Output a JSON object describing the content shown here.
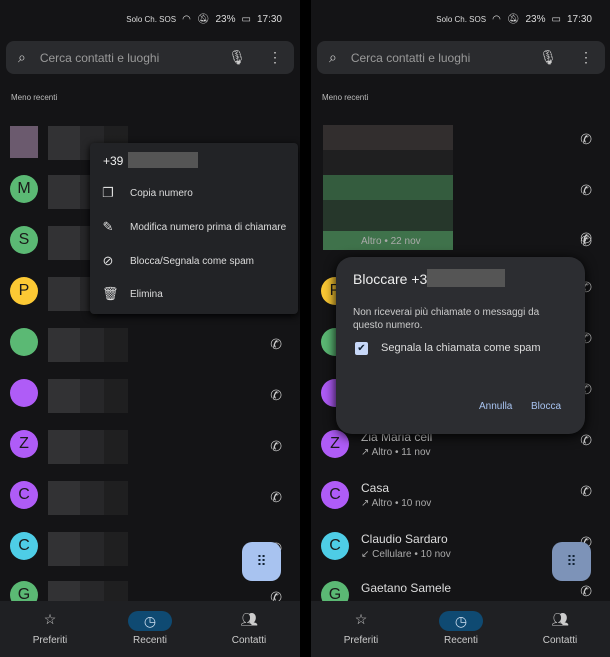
{
  "status": {
    "carrier": "Solo Ch. SOS",
    "battery": "23%",
    "time": "17:30"
  },
  "search": {
    "placeholder": "Cerca contatti e luoghi"
  },
  "section": "Meno recenti",
  "left": {
    "avatars": [
      {
        "letter": "",
        "color": "#6b5a6e"
      },
      {
        "letter": "M",
        "color": "#5bb974"
      },
      {
        "letter": "S",
        "color": "#5bb974"
      },
      {
        "letter": "P",
        "color": "#fcc934"
      },
      {
        "letter": "",
        "color": "#5bb974"
      },
      {
        "letter": "",
        "color": "#af5cf7"
      },
      {
        "letter": "Z",
        "color": "#af5cf7"
      },
      {
        "letter": "C",
        "color": "#af5cf7"
      },
      {
        "letter": "C",
        "color": "#4ecde6"
      },
      {
        "letter": "G",
        "color": "#5bb974"
      }
    ],
    "menu": {
      "number_prefix": "+39",
      "items": [
        {
          "icon": "copy-icon",
          "label": "Copia numero"
        },
        {
          "icon": "pencil-icon",
          "label": "Modifica numero prima di chiamare"
        },
        {
          "icon": "block-icon",
          "label": "Blocca/Segnala come spam"
        },
        {
          "icon": "trash-icon",
          "label": "Elimina"
        }
      ]
    }
  },
  "right": {
    "rows": [
      {
        "letter": "",
        "color": "#5bb974",
        "name": "",
        "sub": "Altro • 22 nov"
      },
      {
        "letter": "P",
        "color": "#fcc934",
        "name": "",
        "sub": ""
      },
      {
        "letter": "",
        "color": "#5bb974",
        "name": "",
        "sub": ""
      },
      {
        "letter": "",
        "color": "#af5cf7",
        "name": "",
        "sub": ""
      },
      {
        "letter": "Z",
        "color": "#af5cf7",
        "name": "Zia Maria cell",
        "sub": "↗ Altro • 11 nov"
      },
      {
        "letter": "C",
        "color": "#af5cf7",
        "name": "Casa",
        "sub": "↗ Altro • 10 nov"
      },
      {
        "letter": "C",
        "color": "#4ecde6",
        "name": "Claudio Sardaro",
        "sub": "↙ Cellulare • 10 nov"
      },
      {
        "letter": "G",
        "color": "#5bb974",
        "name": "Gaetano Samele",
        "sub": ""
      }
    ],
    "dialog": {
      "title": "Bloccare +39",
      "message": "Non riceverai più chiamate o messaggi da questo numero.",
      "checkbox_label": "Segnala la chiamata come spam",
      "checked": true,
      "cancel": "Annulla",
      "confirm": "Blocca"
    }
  },
  "nav": [
    {
      "icon": "star-icon",
      "label": "Preferiti"
    },
    {
      "icon": "clock-icon",
      "label": "Recenti",
      "active": true
    },
    {
      "icon": "contacts-icon",
      "label": "Contatti"
    }
  ]
}
